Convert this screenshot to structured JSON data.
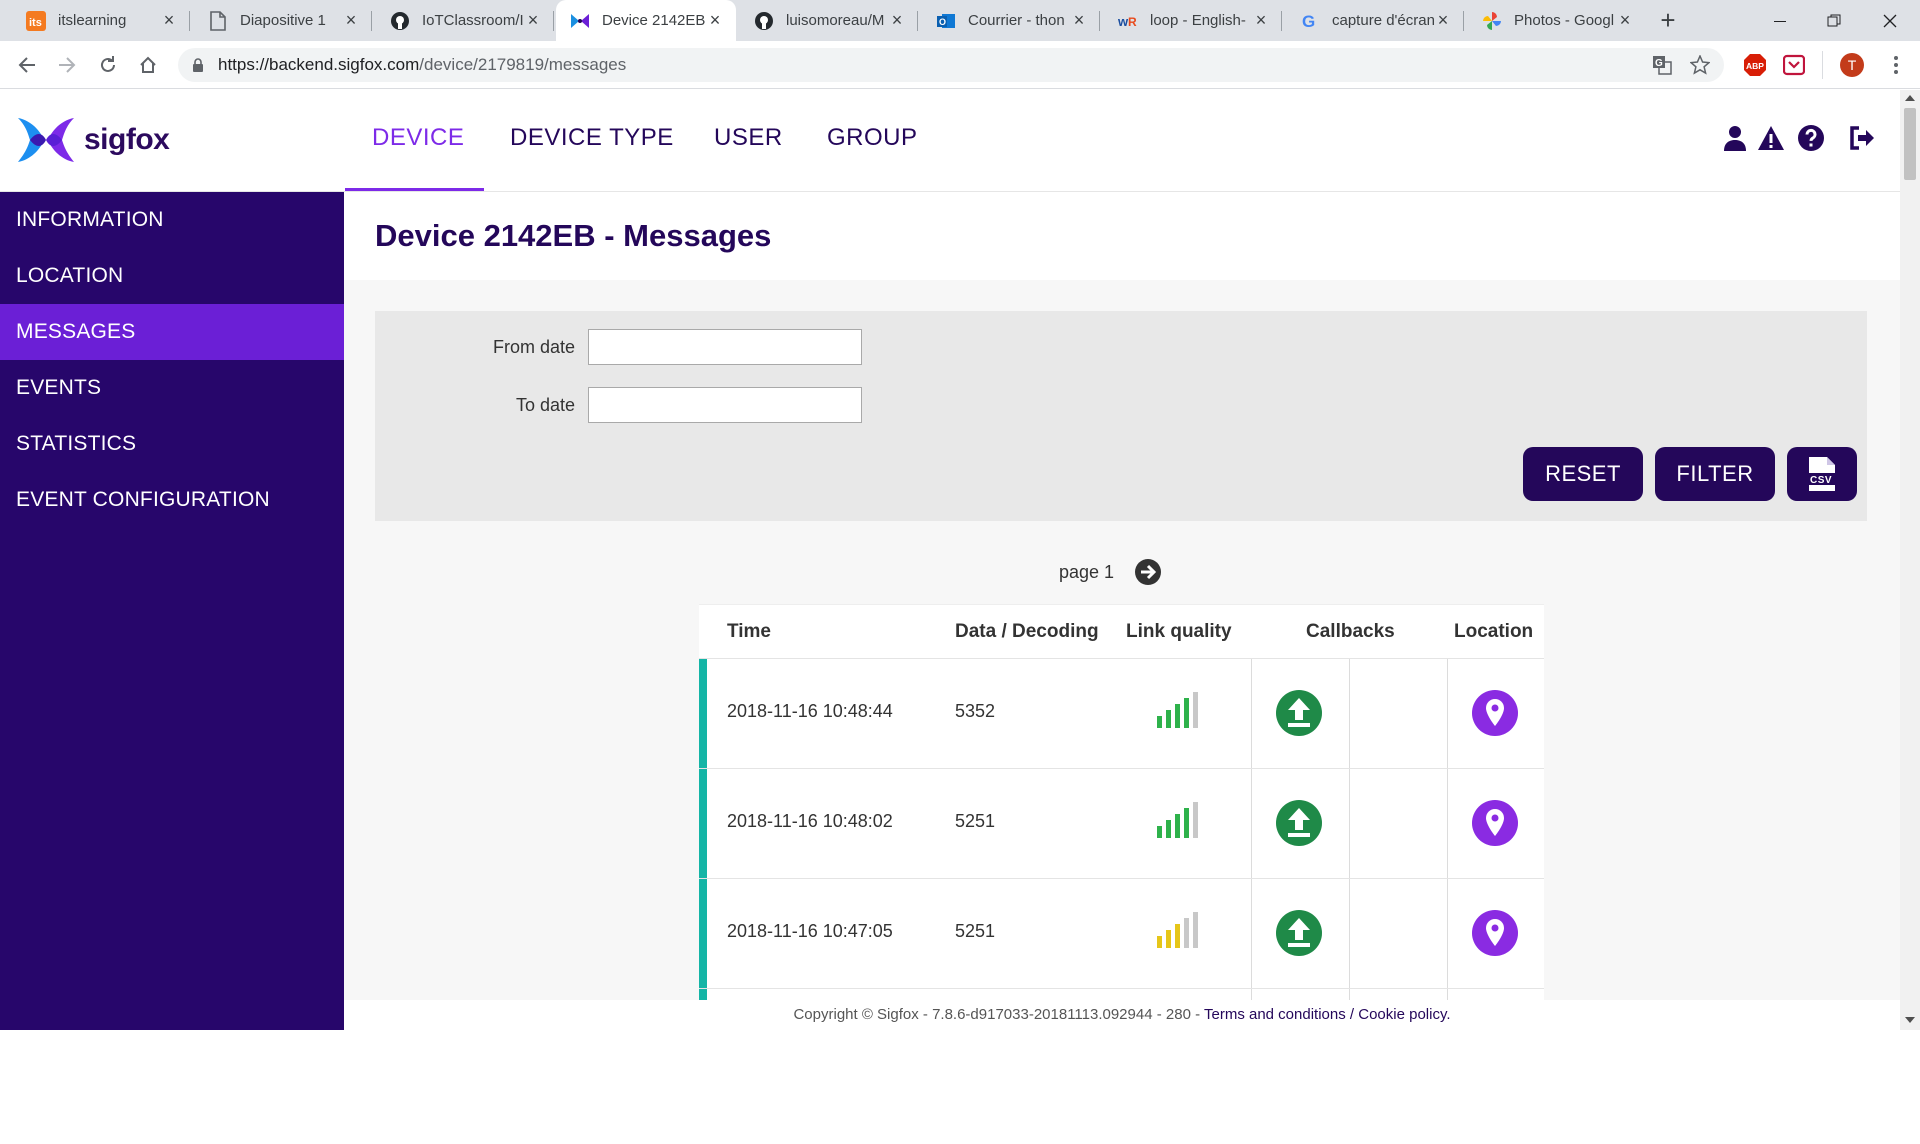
{
  "browser": {
    "tabs": [
      {
        "title": "itslearning"
      },
      {
        "title": "Diapositive 1"
      },
      {
        "title": "IoTClassroom/I"
      },
      {
        "title": "Device 2142EB"
      },
      {
        "title": "luisomoreau/M"
      },
      {
        "title": "Courrier - thon"
      },
      {
        "title": "loop - English-"
      },
      {
        "title": "capture d'écran"
      },
      {
        "title": "Photos - Googl"
      }
    ],
    "url_host": "https://backend.sigfox.com",
    "url_path": "/device/2179819/messages",
    "profile_initial": "T",
    "abp_label": "ABP"
  },
  "header": {
    "logo_text": "sigfox",
    "nav": [
      "DEVICE",
      "DEVICE TYPE",
      "USER",
      "GROUP"
    ],
    "active_nav": "DEVICE"
  },
  "sidebar": {
    "items": [
      "INFORMATION",
      "LOCATION",
      "MESSAGES",
      "EVENTS",
      "STATISTICS",
      "EVENT CONFIGURATION"
    ],
    "active": "MESSAGES"
  },
  "page": {
    "title": "Device 2142EB - Messages",
    "filter": {
      "from_label": "From date",
      "to_label": "To date",
      "from_value": "",
      "to_value": "",
      "reset_label": "RESET",
      "filter_label": "FILTER",
      "csv_label": "CSV"
    },
    "pager_text": "page 1"
  },
  "table": {
    "headers": [
      "Time",
      "Data / Decoding",
      "Link quality",
      "Callbacks",
      "Location"
    ],
    "rows": [
      {
        "time": "2018-11-16 10:48:44",
        "data": "5352",
        "link_bars": 4,
        "link_color": "#2eb24b"
      },
      {
        "time": "2018-11-16 10:48:02",
        "data": "5251",
        "link_bars": 4,
        "link_color": "#2eb24b"
      },
      {
        "time": "2018-11-16 10:47:05",
        "data": "5251",
        "link_bars": 3,
        "link_color": "#e6c619"
      },
      {
        "time": "",
        "data": "",
        "link_bars": 0,
        "link_color": "#2eb24b"
      }
    ]
  },
  "footer": {
    "copyright": "Copyright © Sigfox - 7.8.6-d917033-20181113.092944 - 280 - ",
    "terms": "Terms and conditions",
    "sep": " / ",
    "cookie": "Cookie policy."
  },
  "colors": {
    "brand_dark": "#24075a",
    "brand_accent": "#7d2ae8",
    "sidebar_bg": "#27066b",
    "sidebar_active": "#6b1fd6",
    "row_marker": "#14b5a6",
    "callback_green": "#1f8a48",
    "location_purple": "#8a2be2"
  }
}
